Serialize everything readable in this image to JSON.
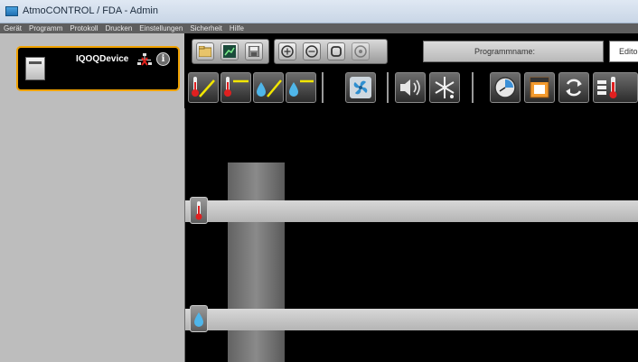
{
  "window": {
    "title": "AtmoCONTROL / FDA - Admin"
  },
  "menu": {
    "items": [
      "Gerät",
      "Programm",
      "Protokoll",
      "Drucken",
      "Einstellungen",
      "Sicherheit",
      "Hilfe"
    ]
  },
  "device": {
    "name": "IQOQDevice",
    "status_icon": "network-disconnected-icon"
  },
  "toolbar": {
    "program_name_label": "Programmname:",
    "edit_label": "Edito"
  },
  "colors": {
    "accent": "#f0a200",
    "panel_bg": "#bdbdbd",
    "chart_bg": "#000000"
  }
}
